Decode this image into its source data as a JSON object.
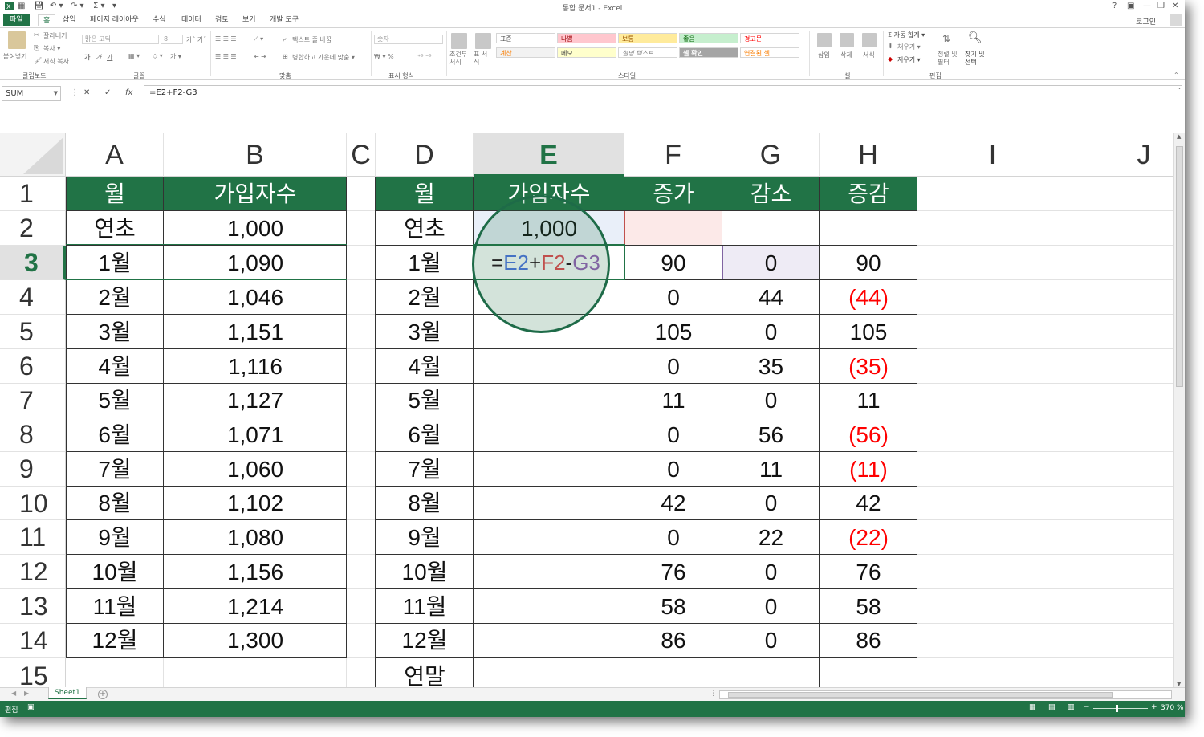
{
  "window": {
    "title": "통합 문서1 - Excel",
    "login": "로그인",
    "help": "?",
    "controls": [
      "—",
      "❐",
      "✕"
    ]
  },
  "tabs": [
    "파일",
    "홈",
    "삽입",
    "페이지 레이아웃",
    "수식",
    "데이터",
    "검토",
    "보기",
    "개발 도구"
  ],
  "ribbon": {
    "clipboard": {
      "paste": "붙여넣기",
      "cut": "잘라내기",
      "copy": "복사 ▾",
      "format_painter": "서식 복사",
      "group": "클립보드"
    },
    "font": {
      "name": "맑은 고딕",
      "size": "8",
      "group": "글꼴",
      "bold": "가",
      "italic": "가",
      "underline": "가"
    },
    "alignment": {
      "wrap": "텍스트 줄 바꿈",
      "merge": "병합하고 가운데 맞춤 ▾",
      "group": "맞춤"
    },
    "number": {
      "format": "숫자",
      "group": "표시 형식"
    },
    "styles": {
      "conditional": "조건부 서식",
      "table": "표 서식",
      "cells": [
        "표준",
        "나쁨",
        "보통",
        "좋음",
        "경고문",
        "계산",
        "메모",
        "설명 텍스트",
        "셀 확인",
        "연결된 셀"
      ],
      "group": "스타일"
    },
    "cells_group": {
      "insert": "삽입",
      "delete": "삭제",
      "format": "서식",
      "group": "셀"
    },
    "editing": {
      "autosum": "Σ 자동 합계 ▾",
      "fill": "채우기 ▾",
      "clear": "지우기 ▾",
      "sort": "정렬 및 필터",
      "find": "찾기 및 선택",
      "group": "편집"
    }
  },
  "formula_bar": {
    "name_box": "SUM",
    "cancel": "✕",
    "enter": "✓",
    "fx": "fx",
    "formula": "=E2+F2-G3"
  },
  "columns": [
    "A",
    "B",
    "C",
    "D",
    "E",
    "F",
    "G",
    "H",
    "I",
    "J"
  ],
  "rows": [
    "1",
    "2",
    "3",
    "4",
    "5",
    "6",
    "7",
    "8",
    "9",
    "10",
    "11",
    "12",
    "13",
    "14",
    "15"
  ],
  "selected": {
    "column": "E",
    "row": "3"
  },
  "table1": {
    "headers": [
      "월",
      "가입자수"
    ],
    "rows": [
      [
        "연초",
        "1,000"
      ],
      [
        "1월",
        "1,090"
      ],
      [
        "2월",
        "1,046"
      ],
      [
        "3월",
        "1,151"
      ],
      [
        "4월",
        "1,116"
      ],
      [
        "5월",
        "1,127"
      ],
      [
        "6월",
        "1,071"
      ],
      [
        "7월",
        "1,060"
      ],
      [
        "8월",
        "1,102"
      ],
      [
        "9월",
        "1,080"
      ],
      [
        "10월",
        "1,156"
      ],
      [
        "11월",
        "1,214"
      ],
      [
        "12월",
        "1,300"
      ]
    ]
  },
  "table2": {
    "headers": [
      "월",
      "가입자수",
      "증가",
      "감소",
      "증감"
    ],
    "rows": [
      [
        "연초",
        "1,000",
        "",
        "",
        ""
      ],
      [
        "1월",
        "",
        "90",
        "0",
        "90"
      ],
      [
        "2월",
        "",
        "0",
        "44",
        "(44)"
      ],
      [
        "3월",
        "",
        "105",
        "0",
        "105"
      ],
      [
        "4월",
        "",
        "0",
        "35",
        "(35)"
      ],
      [
        "5월",
        "",
        "11",
        "0",
        "11"
      ],
      [
        "6월",
        "",
        "0",
        "56",
        "(56)"
      ],
      [
        "7월",
        "",
        "0",
        "11",
        "(11)"
      ],
      [
        "8월",
        "",
        "42",
        "0",
        "42"
      ],
      [
        "9월",
        "",
        "0",
        "22",
        "(22)"
      ],
      [
        "10월",
        "",
        "76",
        "0",
        "76"
      ],
      [
        "11월",
        "",
        "58",
        "0",
        "58"
      ],
      [
        "12월",
        "",
        "86",
        "0",
        "86"
      ],
      [
        "연말",
        "",
        "",
        "",
        ""
      ]
    ]
  },
  "edit_cell": {
    "parts": [
      {
        "text": "=",
        "color": "#222222"
      },
      {
        "text": "E2",
        "color": "#4472c4"
      },
      {
        "text": "+",
        "color": "#222222"
      },
      {
        "text": "F2",
        "color": "#c0504d"
      },
      {
        "text": "-",
        "color": "#222222"
      },
      {
        "text": "G3",
        "color": "#8064a2"
      }
    ]
  },
  "colors": {
    "accent": "#217346",
    "negative": "#ff0000",
    "ref_e2": "#4472c4",
    "ref_f2": "#c0504d",
    "ref_g3": "#8064a2"
  },
  "sheet": {
    "tab": "Sheet1",
    "add": "+"
  },
  "status": {
    "mode": "편집",
    "zoom": "370 %"
  }
}
